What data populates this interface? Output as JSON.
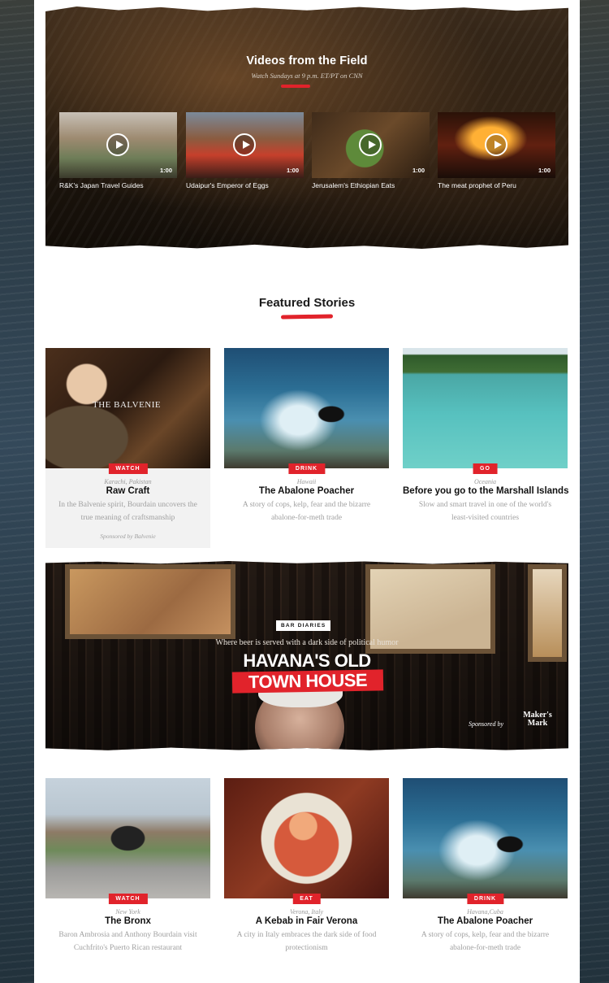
{
  "videos": {
    "title": "Videos from the Field",
    "subtitle": "Watch Sundays at 9 p.m. ET/PT on CNN",
    "items": [
      {
        "title": "R&K's Japan Travel Guides",
        "duration": "1:00"
      },
      {
        "title": "Udaipur's Emperor of Eggs",
        "duration": "1:00"
      },
      {
        "title": "Jerusalem's Ethiopian Eats",
        "duration": "1:00"
      },
      {
        "title": "The meat prophet of Peru",
        "duration": "1:00"
      }
    ]
  },
  "featured": {
    "title": "Featured Stories",
    "stories": [
      {
        "badge": "WATCH",
        "location": "Karachi, Pakistan",
        "title": "Raw Craft",
        "description": "In the Balvenie spirit, Bourdain uncovers the true meaning of craftsmanship",
        "sponsor": "Sponsored by Balvenie",
        "image_text": "THE BALVENIE"
      },
      {
        "badge": "DRINK",
        "location": "Hawaii",
        "title": "The Abalone Poacher",
        "description": "A story of cops, kelp, fear and the bizarre abalone-for-meth trade"
      },
      {
        "badge": "GO",
        "location": "Oceania",
        "title": "Before you go to the Marshall Islands",
        "description": "Slow and smart travel in one of the world's least-visited countries"
      }
    ]
  },
  "banner": {
    "label": "BAR DIARIES",
    "subtitle": "Where beer is served with a dark side of political humor",
    "title_line1": "HAVANA'S OLD",
    "title_line2": "TOWN HOUSE",
    "sponsor_label": "Sponsored by",
    "sponsor_brand": "Maker's Mark"
  },
  "more_stories": [
    {
      "badge": "WATCH",
      "location": "New York",
      "title": "The Bronx",
      "description": "Baron Ambrosia and Anthony Bourdain visit Cuchfrito's Puerto Rican restaurant"
    },
    {
      "badge": "EAT",
      "location": "Verona, Italy",
      "title": "A Kebab in Fair Verona",
      "description": "A city in Italy embraces the dark side of food protectionism"
    },
    {
      "badge": "DRINK",
      "location": "Havana,Cuba",
      "title": "The Abalone Poacher",
      "description": "A story of cops, kelp, fear and the bizarre abalone-for-meth trade"
    }
  ],
  "colors": {
    "accent": "#e1232b",
    "badge_text": "#ffffff"
  }
}
